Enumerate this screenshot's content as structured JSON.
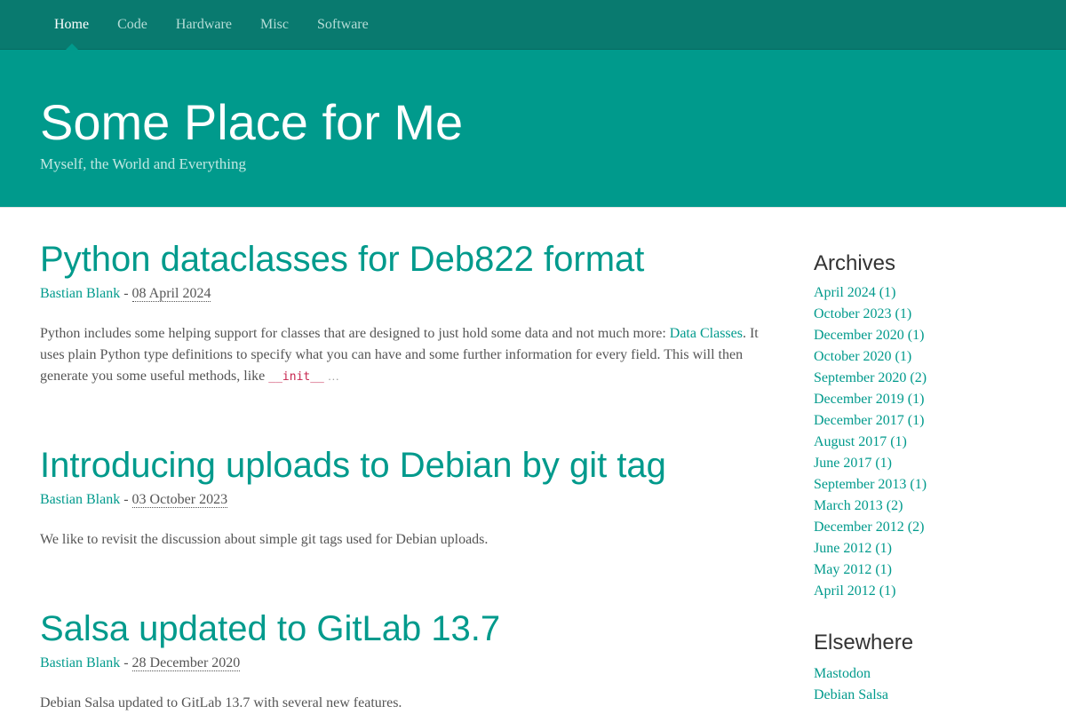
{
  "nav": {
    "items": [
      {
        "label": "Home",
        "active": true
      },
      {
        "label": "Code",
        "active": false
      },
      {
        "label": "Hardware",
        "active": false
      },
      {
        "label": "Misc",
        "active": false
      },
      {
        "label": "Software",
        "active": false
      }
    ]
  },
  "site": {
    "title": "Some Place for Me",
    "tagline": "Myself, the World and Everything"
  },
  "posts": [
    {
      "title": "Python dataclasses for Deb822 format",
      "author": "Bastian Blank",
      "separator": " - ",
      "date": "08 April 2024",
      "excerpt_before": "Python includes some helping support for classes that are designed to just hold some data and not much more: ",
      "excerpt_link": "Data Classes",
      "excerpt_after": ". It uses plain Python type definitions to specify what you can have and some further information for every field. This will then generate you some useful methods, like ",
      "excerpt_code": "__init__",
      "excerpt_more": "…"
    },
    {
      "title": "Introducing uploads to Debian by git tag",
      "author": "Bastian Blank",
      "separator": " - ",
      "date": "03 October 2023",
      "excerpt": "We like to revisit the discussion about simple git tags used for Debian uploads."
    },
    {
      "title": "Salsa updated to GitLab 13.7",
      "author": "Bastian Blank",
      "separator": " - ",
      "date": "28 December 2020",
      "excerpt": "Debian Salsa updated to GitLab 13.7 with several new features."
    }
  ],
  "sidebar": {
    "archives_heading": "Archives",
    "archives": [
      "April 2024 (1)",
      "October 2023 (1)",
      "December 2020 (1)",
      "October 2020 (1)",
      "September 2020 (2)",
      "December 2019 (1)",
      "December 2017 (1)",
      "August 2017 (1)",
      "June 2017 (1)",
      "September 2013 (1)",
      "March 2013 (2)",
      "December 2012 (2)",
      "June 2012 (1)",
      "May 2012 (1)",
      "April 2012 (1)"
    ],
    "elsewhere_heading": "Elsewhere",
    "elsewhere": [
      "Mastodon",
      "Debian Salsa"
    ]
  },
  "colors": {
    "navbar": "#097a6f",
    "hero": "#009a8c",
    "link": "#009a8c",
    "code": "#c7254e"
  }
}
